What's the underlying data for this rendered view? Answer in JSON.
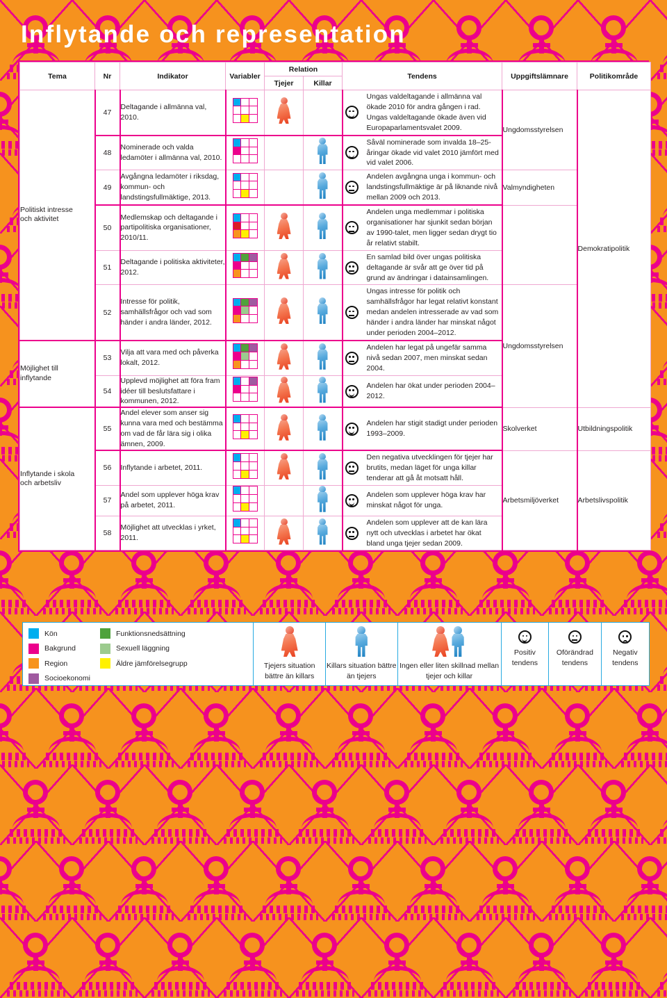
{
  "page": {
    "title": "Inflytande och representation",
    "accent_pink": "#EC008C",
    "accent_orange": "#F6921E",
    "accent_blue": "#27AAE1"
  },
  "table": {
    "headers": {
      "tema": "Tema",
      "nr": "Nr",
      "indikator": "Indikator",
      "variabler": "Variabler",
      "relation": "Relation",
      "tjejer": "Tjejer",
      "killar": "Killar",
      "tendens": "Tendens",
      "uppgiftslamnare": "Uppgiftslämnare",
      "politikomrade": "Politikområde"
    },
    "groups": [
      {
        "label": "Politiskt intresse\noch aktivitet",
        "rows": 6
      },
      {
        "label": "Möjlighet till\ninflytande",
        "rows": 2
      },
      {
        "label": "Inflytande i skola\noch arbetsliv",
        "rows": 4
      }
    ],
    "rows": [
      {
        "nr": "47",
        "indikator": "Deltagande i allmänna val, 2010.",
        "variabler": [
          [
            "kon",
            "none",
            "none"
          ],
          [
            "none",
            "none",
            "none"
          ],
          [
            "none",
            "alder",
            "none"
          ]
        ],
        "tjejer": true,
        "killar": false,
        "tendens": "Ungas valdeltagande i allmänna val ökade 2010 för andra gången i rad. Ungas valdeltagande ökade även vid Europaparlamentsvalet 2009.",
        "trend": "positiv",
        "uppgiftslamnare": "Ungdomsstyrelsen",
        "politikomrade": ""
      },
      {
        "nr": "48",
        "indikator": "Nominerade och valda ledamöter i allmänna val, 2010.",
        "variabler": [
          [
            "kon",
            "none",
            "none"
          ],
          [
            "bakgrund",
            "none",
            "none"
          ],
          [
            "none",
            "none",
            "none"
          ]
        ],
        "tjejer": false,
        "killar": true,
        "tendens": "Såväl nominerade som invalda 18–25-åringar ökade vid valet 2010 jämfört med vid valet 2006.",
        "trend": "positiv",
        "uppgiftslamnare": "",
        "politikomrade": ""
      },
      {
        "nr": "49",
        "indikator": "Avgångna ledamöter i riksdag, kommun- och landstingsfullmäktige, 2013.",
        "variabler": [
          [
            "kon",
            "none",
            "none"
          ],
          [
            "none",
            "none",
            "none"
          ],
          [
            "none",
            "alder",
            "none"
          ]
        ],
        "tjejer": false,
        "killar": true,
        "tendens": "Andelen avgångna unga i kommun- och landstingsfullmäktige är på liknande nivå mellan 2009 och 2013.",
        "trend": "oforandrad",
        "uppgiftslamnare": "Valmyndigheten",
        "politikomrade": ""
      },
      {
        "nr": "50",
        "indikator": "Medlemskap och deltagande i partipolitiska organisationer, 2010/11.",
        "variabler": [
          [
            "kon",
            "none",
            "none"
          ],
          [
            "rod",
            "none",
            "none"
          ],
          [
            "region",
            "alder",
            "none"
          ]
        ],
        "tjejer": true,
        "killar": true,
        "tendens": "Andelen unga medlemmar i politiska organisationer har sjunkit sedan början av 1990-talet, men ligger sedan drygt tio år relativt stabilt.",
        "trend": "oforandrad",
        "uppgiftslamnare": "",
        "politikomrade": "Demokratipolitik"
      },
      {
        "nr": "51",
        "indikator": "Deltagande i politiska aktiviteter, 2012.",
        "variabler": [
          [
            "kon",
            "funktion",
            "socio"
          ],
          [
            "bakgrund",
            "none",
            "none"
          ],
          [
            "region",
            "none",
            "none"
          ]
        ],
        "tjejer": true,
        "killar": true,
        "tendens": "En samlad bild över ungas politiska deltagande är svår att ge över tid på grund av ändringar i datainsamlingen.",
        "trend": "oforandrad",
        "uppgiftslamnare": "",
        "politikomrade": ""
      },
      {
        "nr": "52",
        "indikator": "Intresse för politik, samhällsfrågor och vad som händer i andra länder, 2012.",
        "variabler": [
          [
            "kon",
            "funktion",
            "socio"
          ],
          [
            "bakgrund",
            "sexuell",
            "none"
          ],
          [
            "region",
            "none",
            "none"
          ]
        ],
        "tjejer": true,
        "killar": true,
        "tendens": "Ungas intresse för politik och samhällsfrågor har legat relativt konstant medan andelen intresserade av vad som händer i andra länder har minskat något under perioden 2004–2012.",
        "trend": "oforandrad",
        "uppgiftslamnare": "Ungdomsstyrelsen",
        "politikomrade": ""
      },
      {
        "nr": "53",
        "indikator": "Vilja att vara med och påverka lokalt, 2012.",
        "variabler": [
          [
            "kon",
            "funktion",
            "socio"
          ],
          [
            "bakgrund",
            "sexuell",
            "none"
          ],
          [
            "region",
            "none",
            "none"
          ]
        ],
        "tjejer": true,
        "killar": true,
        "tendens": "Andelen har legat på ungefär samma nivå sedan 2007, men minskat sedan 2004.",
        "trend": "oforandrad",
        "uppgiftslamnare": "",
        "politikomrade": ""
      },
      {
        "nr": "54",
        "indikator": "Upplevd möjlighet att föra fram idéer till beslutsfattare i kommunen, 2012.",
        "variabler": [
          [
            "kon",
            "none",
            "socio"
          ],
          [
            "bakgrund",
            "none",
            "none"
          ],
          [
            "none",
            "none",
            "none"
          ]
        ],
        "tjejer": true,
        "killar": true,
        "tendens": "Andelen har ökat under perioden 2004–2012.",
        "trend": "positiv",
        "uppgiftslamnare": "",
        "politikomrade": ""
      },
      {
        "nr": "55",
        "indikator": "Andel elever som anser sig kunna vara med och bestämma om vad de får lära sig i olika ämnen, 2009.",
        "variabler": [
          [
            "kon",
            "none",
            "none"
          ],
          [
            "none",
            "none",
            "none"
          ],
          [
            "none",
            "alder",
            "none"
          ]
        ],
        "tjejer": true,
        "killar": true,
        "tendens": "Andelen har stigit stadigt under perioden 1993–2009.",
        "trend": "positiv",
        "uppgiftslamnare": "Skolverket",
        "politikomrade": "Utbildningspolitik"
      },
      {
        "nr": "56",
        "indikator": "Inflytande i arbetet, 2011.",
        "variabler": [
          [
            "kon",
            "none",
            "none"
          ],
          [
            "none",
            "none",
            "none"
          ],
          [
            "none",
            "alder",
            "none"
          ]
        ],
        "tjejer": true,
        "killar": true,
        "tendens": "Den negativa utvecklingen för tjejer har brutits, medan läget för unga killar tenderar att gå åt motsatt håll.",
        "trend": "oforandrad",
        "uppgiftslamnare": "",
        "politikomrade": ""
      },
      {
        "nr": "57",
        "indikator": "Andel som upplever höga krav på arbetet, 2011.",
        "variabler": [
          [
            "kon",
            "none",
            "none"
          ],
          [
            "none",
            "none",
            "none"
          ],
          [
            "none",
            "alder",
            "none"
          ]
        ],
        "tjejer": false,
        "killar": true,
        "tendens": "Andelen som upplever höga krav har minskat något för unga.",
        "trend": "positiv",
        "uppgiftslamnare": "Arbetsmiljöverket",
        "politikomrade": "Arbetslivspolitik"
      },
      {
        "nr": "58",
        "indikator": "Möjlighet att utvecklas i yrket, 2011.",
        "variabler": [
          [
            "kon",
            "none",
            "none"
          ],
          [
            "none",
            "none",
            "none"
          ],
          [
            "none",
            "alder",
            "none"
          ]
        ],
        "tjejer": true,
        "killar": true,
        "tendens": "Andelen som upplever att de kan lära nytt och utvecklas i arbetet har ökat bland unga tjejer sedan 2009.",
        "trend": "oforandrad",
        "uppgiftslamnare": "",
        "politikomrade": ""
      }
    ]
  },
  "legend": {
    "variables_col1": [
      {
        "key": "kon",
        "label": "Kön",
        "color": "#00AEEF"
      },
      {
        "key": "bakgrund",
        "label": "Bakgrund",
        "color": "#EC008C"
      },
      {
        "key": "region",
        "label": "Region",
        "color": "#F7941E"
      },
      {
        "key": "socio",
        "label": "Socioekonomi",
        "color": "#A05AA0"
      }
    ],
    "variables_col2": [
      {
        "key": "funktion",
        "label": "Funktionsnedsättning",
        "color": "#4FA23B"
      },
      {
        "key": "sexuell",
        "label": "Sexuell läggning",
        "color": "#9CCB8E"
      },
      {
        "key": "alder",
        "label": "Äldre jämförelsegrupp",
        "color": "#FFF100"
      }
    ],
    "relations": [
      {
        "key": "tjejer-better",
        "caption": "Tjejers situation bättre än killars"
      },
      {
        "key": "killar-better",
        "caption": "Killars situation bättre än tjejers"
      },
      {
        "key": "no-difference",
        "caption": "Ingen eller liten skillnad mellan tjejer och killar"
      }
    ],
    "trends": [
      {
        "key": "positiv",
        "caption": "Positiv tendens"
      },
      {
        "key": "oforandrad",
        "caption": "Oförändrad tendens"
      },
      {
        "key": "negativ",
        "caption": "Negativ tendens"
      }
    ]
  }
}
